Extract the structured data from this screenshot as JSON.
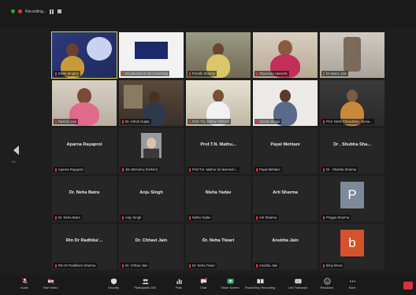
{
  "topbar": {
    "recording_label": "Recording..."
  },
  "colors": {
    "accent": "#d8d24a",
    "end": "#d9323b",
    "mic_off": "#e33333"
  },
  "gallery": {
    "page_indicator": "1/5",
    "tiles": [
      {
        "big": "",
        "label": "Bimla Singhal"
      },
      {
        "big": "",
        "label": "IIS (deemed to be University)"
      },
      {
        "big": "",
        "label": "Preethi Sharma"
      },
      {
        "big": "",
        "label": "Shyamala Hareesh"
      },
      {
        "big": "",
        "label": "Dr Neeru Jain"
      },
      {
        "big": "",
        "label": "Rashmi Jain"
      },
      {
        "big": "",
        "label": "Dr. Ashok Gupta"
      },
      {
        "big": "",
        "label": "Prof. T.N. Mathur (RDVV)"
      },
      {
        "big": "",
        "label": "Chetan Singai"
      },
      {
        "big": "",
        "label": "Prof. Nimit Chowdhary, Jamia..."
      },
      {
        "big": "Aparna Rayaprol",
        "label": "Aparna Rayaprol"
      },
      {
        "big": "",
        "label": "Jim McKinley (he/him)"
      },
      {
        "big": "Prof.T.N. Mathu...",
        "label": "Prof.T.N. Mathur (is deemed t..."
      },
      {
        "big": "Payal Mehtani",
        "label": "Payal Mehtani"
      },
      {
        "big": "Dr . Shubha Sha...",
        "label": "Dr . Shubha Sharma"
      },
      {
        "big": "Dr. Neha Batra",
        "label": "Dr. Neha Batra"
      },
      {
        "big": "Anju Singh",
        "label": "Anju Singh"
      },
      {
        "big": "Nisha Yadav",
        "label": "Nisha Yadav"
      },
      {
        "big": "Arti Sharma",
        "label": "Arti Sharma"
      },
      {
        "big": "",
        "label": "Pragya Sharma",
        "avatar": "P"
      },
      {
        "big": "Rtn Dr Radhika'...",
        "label": "Rtn Dr Radhika's Sharma"
      },
      {
        "big": "Dr. Chhavi Jain",
        "label": "Dr. Chhavi Jain"
      },
      {
        "big": "Dr. Neha Tiwari",
        "label": "Dr. Neha Tiwari"
      },
      {
        "big": "Anubha Jain",
        "label": "Anubha Jain"
      },
      {
        "big": "",
        "label": "bimy khera",
        "avatar": "b"
      }
    ]
  },
  "toolbar": {
    "audio": "Audio",
    "video": "Start Video",
    "security": "Security",
    "participants": "Participants",
    "participant_count": "155",
    "polls": "Polls",
    "chat": "Chat",
    "share": "Share Screen",
    "record": "Pause/Stop Recording",
    "transcript": "Live Transcript",
    "reactions": "Reactions",
    "more": "More"
  }
}
